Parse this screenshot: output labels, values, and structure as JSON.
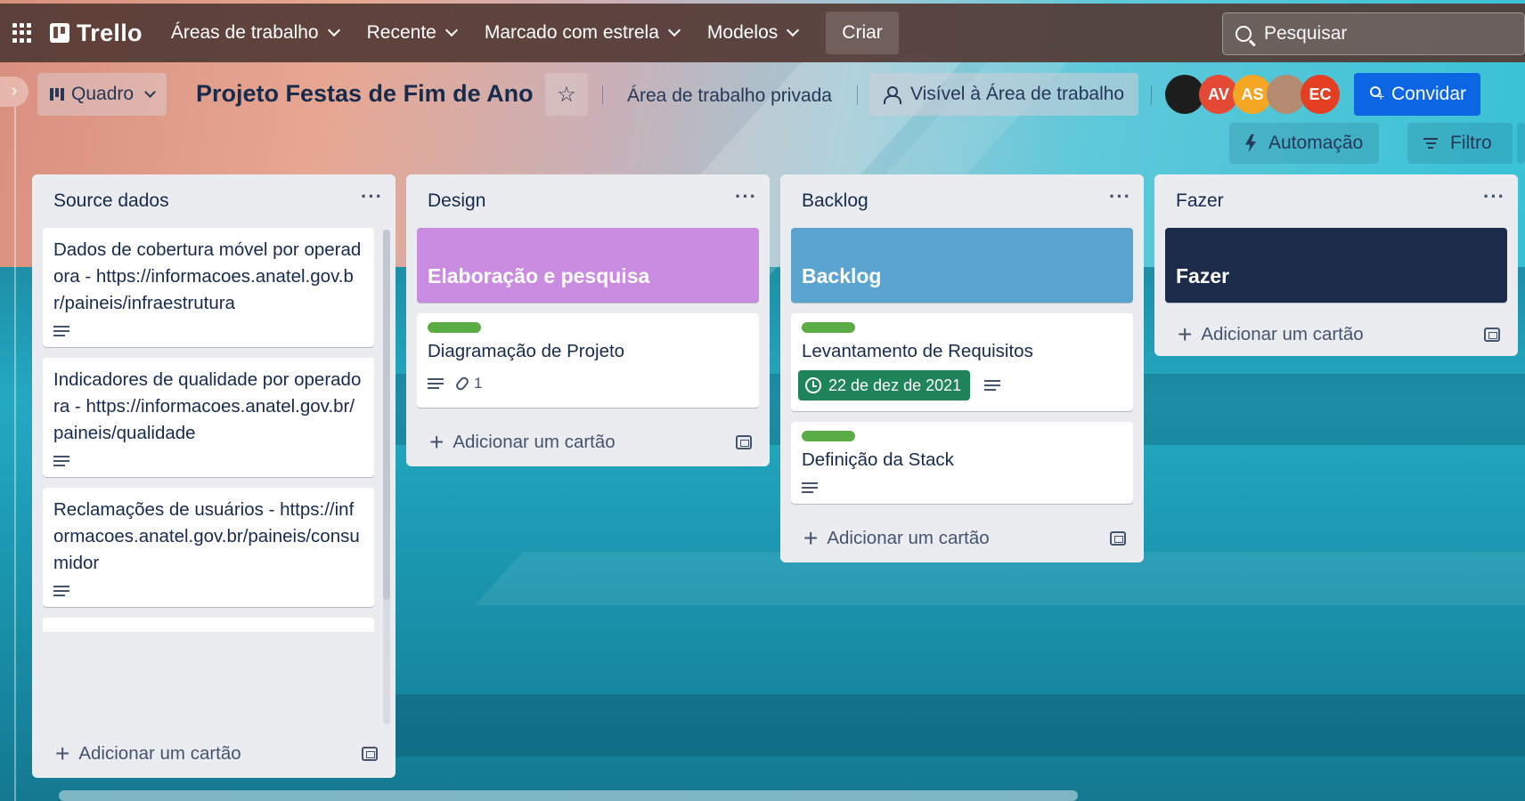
{
  "nav": {
    "logo": "Trello",
    "items": [
      {
        "label": "Áreas de trabalho"
      },
      {
        "label": "Recente"
      },
      {
        "label": "Marcado com estrela"
      },
      {
        "label": "Modelos"
      }
    ],
    "create_label": "Criar",
    "search_placeholder": "Pesquisar"
  },
  "board": {
    "view_label": "Quadro",
    "title": "Projeto Festas de Fim de Ano",
    "workspace_label": "Área de trabalho privada",
    "visibility_label": "Visível à Área de trabalho",
    "members": [
      {
        "initials": "",
        "color": "#1d1d1d"
      },
      {
        "initials": "AV",
        "color": "#e34935"
      },
      {
        "initials": "AS",
        "color": "#f5a623"
      },
      {
        "initials": "",
        "color": "#b48a70"
      },
      {
        "initials": "EC",
        "color": "#e43f23"
      }
    ],
    "invite_label": "Convidar",
    "automation_label": "Automação",
    "filter_label": "Filtro"
  },
  "lists": [
    {
      "title": "Source dados",
      "cards": [
        {
          "title": "Dados de cobertura móvel por operadora - https://informacoes.anatel.gov.br/paineis/infraestrutura",
          "has_description": true
        },
        {
          "title": "Indicadores de qualidade por operadora - https://informacoes.anatel.gov.br/paineis/qualidade",
          "has_description": true
        },
        {
          "title": "Reclamações de usuários - https://informacoes.anatel.gov.br/paineis/consumidor",
          "has_description": true
        }
      ],
      "add_label": "Adicionar um cartão"
    },
    {
      "title": "Design",
      "cover_card": {
        "title": "Elaboração e pesquisa",
        "color": "#c98ce0"
      },
      "cards": [
        {
          "title": "Diagramação de Projeto",
          "label_color": "#5aac44",
          "has_description": true,
          "attachments": "1"
        }
      ],
      "add_label": "Adicionar um cartão"
    },
    {
      "title": "Backlog",
      "cover_card": {
        "title": "Backlog",
        "color": "#5ba4cf"
      },
      "cards": [
        {
          "title": "Levantamento de Requisitos",
          "label_color": "#5aac44",
          "due": "22 de dez de 2021",
          "has_description": true
        },
        {
          "title": "Definição da Stack",
          "label_color": "#5aac44",
          "has_description": true
        }
      ],
      "add_label": "Adicionar um cartão"
    },
    {
      "title": "Fazer",
      "cover_card": {
        "title": "Fazer",
        "color": "#1d2b4a"
      },
      "cards": [],
      "add_label": "Adicionar um cartão"
    }
  ],
  "colors": {
    "nav_bg": "#543a34",
    "invite_bg": "#0c66e4",
    "list_bg": "#ebecf0",
    "due_bg": "#1f845a"
  }
}
